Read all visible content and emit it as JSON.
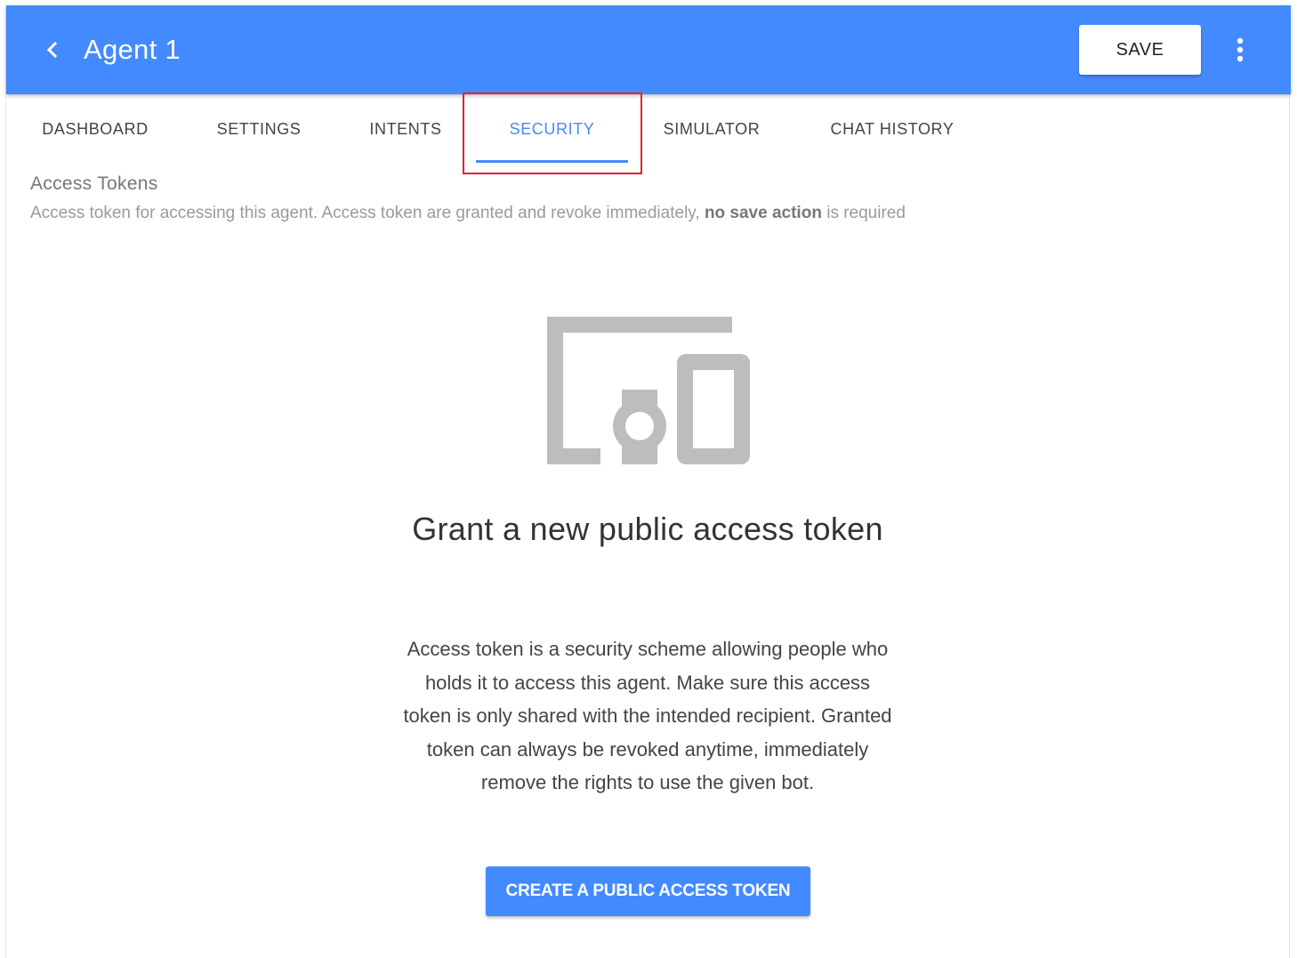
{
  "header": {
    "back_icon": "chevron-left-icon",
    "title": "Agent 1",
    "save_label": "SAVE",
    "more_icon": "more-vert-icon",
    "accent_color": "#448aff"
  },
  "tabs": [
    {
      "label": "DASHBOARD",
      "active": false
    },
    {
      "label": "SETTINGS",
      "active": false
    },
    {
      "label": "INTENTS",
      "active": false
    },
    {
      "label": "SECURITY",
      "active": true
    },
    {
      "label": "SIMULATOR",
      "active": false
    },
    {
      "label": "CHAT HISTORY",
      "active": false
    }
  ],
  "section": {
    "title": "Access Tokens",
    "description_prefix": "Access token for accessing this agent. Access token are granted and revoke immediately, ",
    "description_bold": "no save action",
    "description_suffix": " is required"
  },
  "empty_state": {
    "illustration_icon": "devices-icon",
    "heading": "Grant a new public access token",
    "body": "Access token is a security scheme allowing people who holds it to access this agent. Make sure this access token is only shared with the intended recipient. Granted token can always be revoked anytime, immediately remove the rights to use the given bot.",
    "button_label": "CREATE A PUBLIC ACCESS TOKEN"
  },
  "highlight_color": "#e0242f"
}
